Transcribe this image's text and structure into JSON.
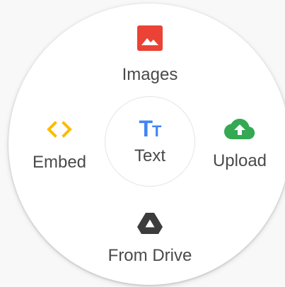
{
  "menu": {
    "images": {
      "label": "Images",
      "icon": "image-icon",
      "color": "#ea4335"
    },
    "embed": {
      "label": "Embed",
      "icon": "code-icon",
      "color": "#fbbc04"
    },
    "text": {
      "label": "Text",
      "icon": "text-format-icon",
      "glyph_big": "T",
      "glyph_small": "T",
      "color": "#4285f4"
    },
    "upload": {
      "label": "Upload",
      "icon": "cloud-upload-icon",
      "color": "#34a853"
    },
    "drive": {
      "label": "From Drive",
      "icon": "google-drive-icon",
      "color": "#3c3c3c"
    }
  },
  "colors": {
    "label_text": "#4a4a4a",
    "disc_background": "#ffffff"
  }
}
